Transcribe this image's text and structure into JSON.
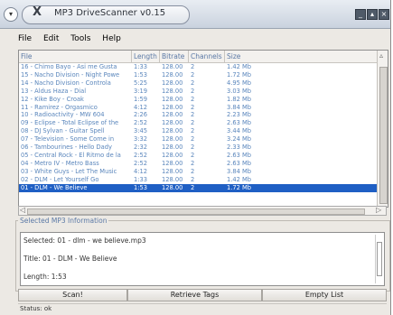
{
  "window": {
    "title": "MP3 DriveScanner v0.15",
    "close_glyph": "X"
  },
  "menu": [
    "File",
    "Edit",
    "Tools",
    "Help"
  ],
  "columns": [
    "File",
    "Length",
    "Bitrate",
    "Channels",
    "Size"
  ],
  "rows": [
    [
      "16 - Chimo Bayo - Asi me Gusta",
      "1:33",
      "128.00",
      "2",
      "1.42 Mb"
    ],
    [
      "15 - Nacho Division - Night Powe",
      "1:53",
      "128.00",
      "2",
      "1.72 Mb"
    ],
    [
      "14 - Nacho Division - Controla",
      "5:25",
      "128.00",
      "2",
      "4.95 Mb"
    ],
    [
      "13 - Aldus Haza - Dial",
      "3:19",
      "128.00",
      "2",
      "3.03 Mb"
    ],
    [
      "12 - Kike Boy - Croak",
      "1:59",
      "128.00",
      "2",
      "1.82 Mb"
    ],
    [
      "11 - Ramirez - Orgasmico",
      "4:12",
      "128.00",
      "2",
      "3.84 Mb"
    ],
    [
      "10 - Radioactivity - MW 604",
      "2:26",
      "128.00",
      "2",
      "2.23 Mb"
    ],
    [
      "09 - Eclipse - Total Eclipse of the",
      "2:52",
      "128.00",
      "2",
      "2.63 Mb"
    ],
    [
      "08 - DJ Sylvan - Guitar Spell",
      "3:45",
      "128.00",
      "2",
      "3.44 Mb"
    ],
    [
      "07 - Television - Some Come in",
      "3:32",
      "128.00",
      "2",
      "3.24 Mb"
    ],
    [
      "06 - Tambourines - Hello Dady",
      "2:32",
      "128.00",
      "2",
      "2.33 Mb"
    ],
    [
      "05 - Central Rock - El Ritmo de la",
      "2:52",
      "128.00",
      "2",
      "2.63 Mb"
    ],
    [
      "04 - Metro IV - Metro Bass",
      "2:52",
      "128.00",
      "2",
      "2.63 Mb"
    ],
    [
      "03 - White Guys - Let The Music",
      "4:12",
      "128.00",
      "2",
      "3.84 Mb"
    ],
    [
      "02 - DLM - Let Yourself Go",
      "1:33",
      "128.00",
      "2",
      "1.42 Mb"
    ],
    [
      "01 - DLM - We Believe",
      "1:53",
      "128.00",
      "2",
      "1.72 Mb"
    ]
  ],
  "selected_row_index": 15,
  "info": {
    "legend": "Selected MP3 Information",
    "selected": "Selected: 01 - dlm - we believe.mp3",
    "title": "Title: 01 - DLM - We Believe",
    "length": "Length: 1:53"
  },
  "buttons": {
    "scan": "Scan!",
    "retrieve": "Retrieve Tags",
    "empty": "Empty List"
  },
  "status": "Status: ok",
  "colors": {
    "selected_bg": "#1f5fc4",
    "row_text": "#5a86bc",
    "header_text": "#5b79a6"
  }
}
